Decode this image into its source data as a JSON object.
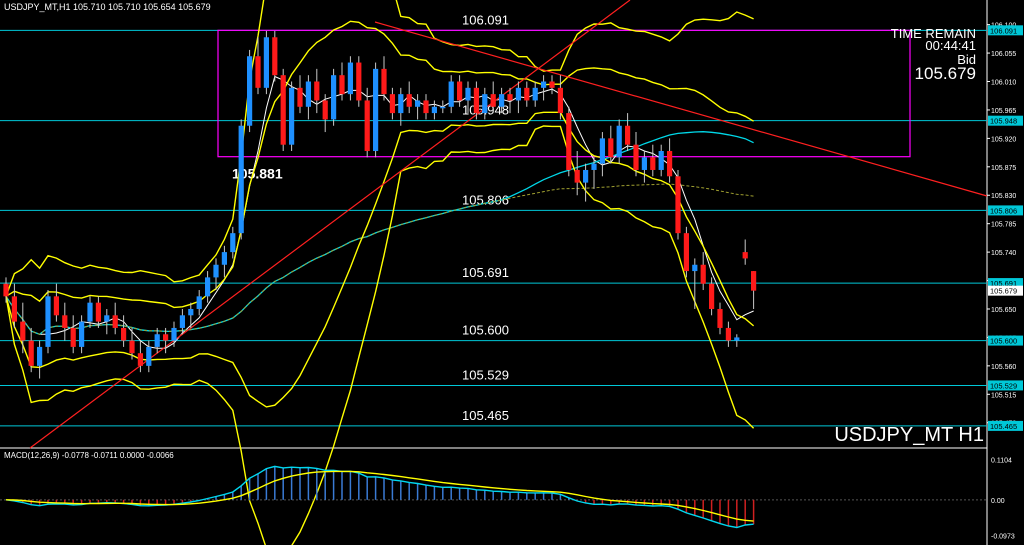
{
  "window": {
    "header": "USDJPY_MT,H1  105.710 105.710 105.654 105.679",
    "symbol_label": "USDJPY_MT H1"
  },
  "panel": {
    "time_remain_label": "TIME REMAIN",
    "time_remain": "00:44:41",
    "bid_label": "Bid",
    "bid": "105.679"
  },
  "colors": {
    "background": "#000000",
    "bull": "#1e90ff",
    "bear": "#ff1a1a",
    "level_line": "#00c8d8",
    "bollinger": "#ffff00",
    "box": "#ff00ff",
    "trendline": "#ff2020",
    "ma_cyan": "#00d8e8",
    "ma_white": "#ffffff",
    "ma_olive": "#a0a030",
    "macd_line": "#00d8f0",
    "macd_signal": "#ffff00"
  },
  "chart_data": [
    {
      "type": "candlestick",
      "title": "USDJPY_MT H1",
      "ylim": [
        105.43,
        106.12
      ],
      "y_ticks": [
        "106.100",
        "106.055",
        "106.010",
        "105.965",
        "105.920",
        "105.875",
        "105.830",
        "105.785",
        "105.740",
        "105.695",
        "105.650",
        "105.605",
        "105.560",
        "105.515",
        "105.470"
      ],
      "price_tags": [
        "106.091",
        "105.948",
        "105.806",
        "105.691",
        "105.679",
        "105.600",
        "105.529",
        "105.465"
      ],
      "levels": [
        {
          "label": "106.091",
          "value": 106.091
        },
        {
          "label": "105.948",
          "value": 105.948
        },
        {
          "label": "105.806",
          "value": 105.806
        },
        {
          "label": "105.691",
          "value": 105.691
        },
        {
          "label": "105.600",
          "value": 105.6
        },
        {
          "label": "105.529",
          "value": 105.529
        },
        {
          "label": "105.465",
          "value": 105.465
        }
      ],
      "annotation": "105.881",
      "range_box": [
        105.891,
        106.091
      ],
      "candles": [
        [
          105.69,
          105.7,
          105.66,
          105.67
        ],
        [
          105.67,
          105.69,
          105.62,
          105.63
        ],
        [
          105.63,
          105.66,
          105.58,
          105.6
        ],
        [
          105.6,
          105.62,
          105.55,
          105.56
        ],
        [
          105.56,
          105.6,
          105.54,
          105.59
        ],
        [
          105.59,
          105.68,
          105.58,
          105.67
        ],
        [
          105.67,
          105.69,
          105.63,
          105.64
        ],
        [
          105.64,
          105.66,
          105.6,
          105.62
        ],
        [
          105.62,
          105.64,
          105.58,
          105.59
        ],
        [
          105.59,
          105.64,
          105.58,
          105.63
        ],
        [
          105.63,
          105.67,
          105.62,
          105.66
        ],
        [
          105.66,
          105.67,
          105.62,
          105.63
        ],
        [
          105.63,
          105.65,
          105.61,
          105.64
        ],
        [
          105.64,
          105.66,
          105.61,
          105.62
        ],
        [
          105.62,
          105.64,
          105.59,
          105.6
        ],
        [
          105.6,
          105.62,
          105.57,
          105.58
        ],
        [
          105.58,
          105.6,
          105.55,
          105.56
        ],
        [
          105.56,
          105.6,
          105.55,
          105.59
        ],
        [
          105.59,
          105.62,
          105.58,
          105.61
        ],
        [
          105.61,
          105.62,
          105.58,
          105.6
        ],
        [
          105.6,
          105.63,
          105.59,
          105.62
        ],
        [
          105.62,
          105.65,
          105.61,
          105.64
        ],
        [
          105.64,
          105.66,
          105.62,
          105.65
        ],
        [
          105.65,
          105.68,
          105.64,
          105.67
        ],
        [
          105.67,
          105.71,
          105.66,
          105.7
        ],
        [
          105.7,
          105.73,
          105.68,
          105.72
        ],
        [
          105.72,
          105.75,
          105.7,
          105.74
        ],
        [
          105.74,
          105.78,
          105.73,
          105.77
        ],
        [
          105.77,
          105.95,
          105.76,
          105.94
        ],
        [
          105.94,
          106.06,
          105.93,
          106.05
        ],
        [
          106.05,
          106.08,
          105.99,
          106.0
        ],
        [
          106.0,
          106.09,
          105.99,
          106.08
        ],
        [
          106.08,
          106.09,
          106.01,
          106.02
        ],
        [
          106.02,
          106.03,
          105.9,
          105.91
        ],
        [
          105.91,
          106.01,
          105.9,
          106.0
        ],
        [
          106.0,
          106.02,
          105.96,
          105.97
        ],
        [
          105.97,
          106.02,
          105.95,
          106.01
        ],
        [
          106.01,
          106.03,
          105.96,
          105.98
        ],
        [
          105.98,
          105.99,
          105.93,
          105.95
        ],
        [
          105.95,
          106.03,
          105.94,
          106.02
        ],
        [
          106.02,
          106.04,
          105.98,
          105.99
        ],
        [
          105.99,
          106.05,
          105.98,
          106.04
        ],
        [
          106.04,
          106.05,
          105.97,
          105.98
        ],
        [
          105.98,
          106.0,
          105.89,
          105.9
        ],
        [
          105.9,
          106.04,
          105.89,
          106.03
        ],
        [
          106.03,
          106.05,
          105.98,
          105.99
        ],
        [
          105.99,
          106.0,
          105.95,
          105.96
        ],
        [
          105.96,
          106.0,
          105.94,
          105.99
        ],
        [
          105.99,
          106.01,
          105.96,
          105.97
        ],
        [
          105.97,
          105.99,
          105.95,
          105.98
        ],
        [
          105.98,
          105.99,
          105.95,
          105.96
        ],
        [
          105.96,
          105.98,
          105.95,
          105.97
        ],
        [
          105.97,
          105.98,
          105.96,
          105.97
        ],
        [
          105.97,
          106.02,
          105.96,
          106.01
        ],
        [
          106.01,
          106.02,
          105.97,
          105.98
        ],
        [
          105.98,
          106.01,
          105.96,
          106.0
        ],
        [
          106.0,
          106.01,
          105.95,
          105.96
        ],
        [
          105.96,
          106.0,
          105.95,
          105.99
        ],
        [
          105.99,
          106.01,
          105.96,
          105.97
        ],
        [
          105.97,
          106.0,
          105.96,
          105.99
        ],
        [
          105.99,
          106.0,
          105.96,
          105.98
        ],
        [
          105.98,
          106.01,
          105.96,
          106.0
        ],
        [
          106.0,
          106.01,
          105.97,
          105.98
        ],
        [
          105.98,
          106.01,
          105.97,
          106.0
        ],
        [
          106.0,
          106.02,
          105.98,
          106.01
        ],
        [
          106.01,
          106.02,
          105.99,
          106.0
        ],
        [
          106.0,
          106.02,
          105.95,
          105.96
        ],
        [
          105.96,
          105.97,
          105.86,
          105.87
        ],
        [
          105.87,
          105.9,
          105.83,
          105.85
        ],
        [
          105.85,
          105.88,
          105.82,
          105.87
        ],
        [
          105.87,
          105.89,
          105.84,
          105.88
        ],
        [
          105.88,
          105.93,
          105.86,
          105.92
        ],
        [
          105.92,
          105.94,
          105.88,
          105.89
        ],
        [
          105.89,
          105.95,
          105.88,
          105.94
        ],
        [
          105.94,
          105.96,
          105.9,
          105.91
        ],
        [
          105.91,
          105.93,
          105.86,
          105.87
        ],
        [
          105.87,
          105.9,
          105.85,
          105.89
        ],
        [
          105.89,
          105.91,
          105.86,
          105.87
        ],
        [
          105.87,
          105.91,
          105.86,
          105.9
        ],
        [
          105.9,
          105.92,
          105.85,
          105.86
        ],
        [
          105.86,
          105.87,
          105.76,
          105.77
        ],
        [
          105.77,
          105.78,
          105.7,
          105.71
        ],
        [
          105.71,
          105.73,
          105.65,
          105.72
        ],
        [
          105.72,
          105.74,
          105.68,
          105.69
        ],
        [
          105.69,
          105.7,
          105.64,
          105.65
        ],
        [
          105.65,
          105.66,
          105.61,
          105.62
        ],
        [
          105.62,
          105.63,
          105.59,
          105.6
        ],
        [
          105.6,
          105.61,
          105.59,
          105.605
        ],
        [
          105.74,
          105.76,
          105.72,
          105.73
        ],
        [
          105.71,
          105.71,
          105.65,
          105.679
        ]
      ]
    },
    {
      "type": "histogram",
      "title": "MACD(12,26,9) -0.0778 -0.0711 0.0000 -0.0066",
      "y_ticks": [
        "0.1104",
        "0.00",
        "-0.0973"
      ],
      "ylim": [
        -0.11,
        0.12
      ]
    }
  ]
}
